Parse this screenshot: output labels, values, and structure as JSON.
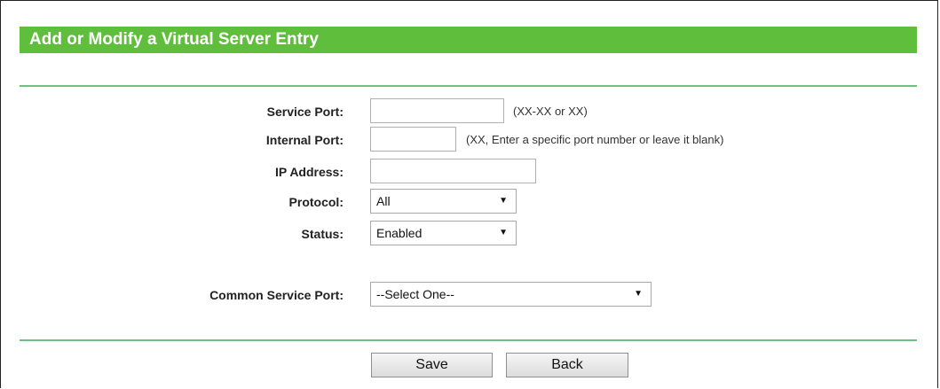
{
  "page": {
    "title": "Add or Modify a Virtual Server Entry"
  },
  "form": {
    "service_port": {
      "label": "Service Port:",
      "value": "",
      "hint": "(XX-XX or XX)"
    },
    "internal_port": {
      "label": "Internal Port:",
      "value": "",
      "hint": "(XX, Enter a specific port number or leave it blank)"
    },
    "ip_address": {
      "label": "IP Address:",
      "value": ""
    },
    "protocol": {
      "label": "Protocol:",
      "selected": "All"
    },
    "status": {
      "label": "Status:",
      "selected": "Enabled"
    },
    "common_service_port": {
      "label": "Common Service Port:",
      "selected": "--Select One--"
    }
  },
  "buttons": {
    "save": "Save",
    "back": "Back"
  },
  "colors": {
    "title_bar": "#5fbf3c",
    "divider": "#6fbf83"
  },
  "icons": {
    "dropdown": "chevron-down-icon"
  }
}
